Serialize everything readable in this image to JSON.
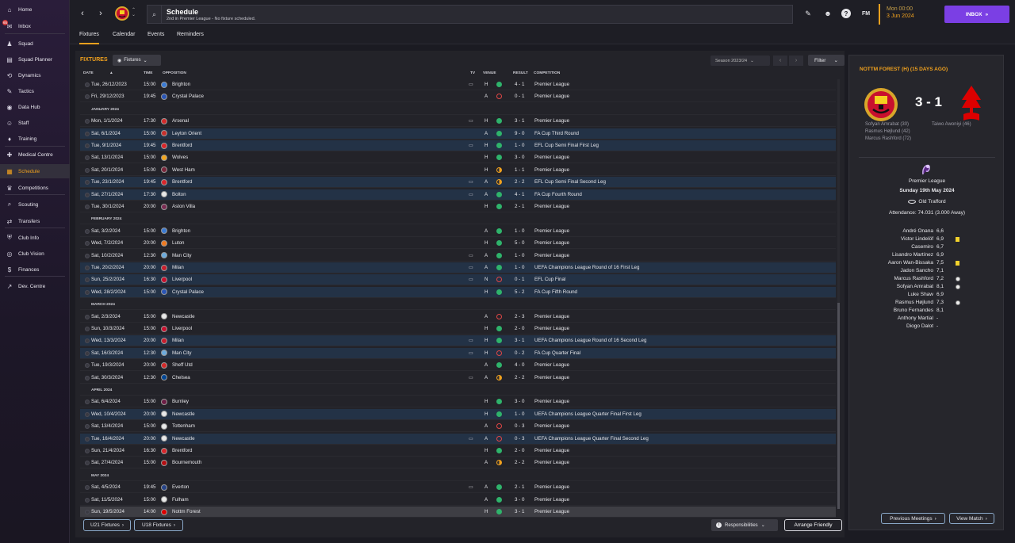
{
  "sidebar": {
    "items": [
      {
        "label": "Home",
        "icon": "⌂",
        "name": "home"
      },
      {
        "label": "Inbox",
        "icon": "✉",
        "name": "inbox",
        "badge": "65"
      },
      {
        "label": "Squad",
        "icon": "♟",
        "name": "squad"
      },
      {
        "label": "Squad Planner",
        "icon": "▤",
        "name": "squad-planner"
      },
      {
        "label": "Dynamics",
        "icon": "⟲",
        "name": "dynamics"
      },
      {
        "label": "Tactics",
        "icon": "✎",
        "name": "tactics"
      },
      {
        "label": "Data Hub",
        "icon": "◉",
        "name": "data-hub"
      },
      {
        "label": "Staff",
        "icon": "☺",
        "name": "staff"
      },
      {
        "label": "Training",
        "icon": "♦",
        "name": "training"
      },
      {
        "label": "Medical Centre",
        "icon": "✚",
        "name": "medical-centre"
      },
      {
        "label": "Schedule",
        "icon": "▦",
        "name": "schedule",
        "active": true
      },
      {
        "label": "Competitions",
        "icon": "♛",
        "name": "competitions"
      },
      {
        "label": "Scouting",
        "icon": "⌕",
        "name": "scouting"
      },
      {
        "label": "Transfers",
        "icon": "⇄",
        "name": "transfers"
      },
      {
        "label": "Club Info",
        "icon": "⛨",
        "name": "club-info"
      },
      {
        "label": "Club Vision",
        "icon": "◎",
        "name": "club-vision"
      },
      {
        "label": "Finances",
        "icon": "$",
        "name": "finances"
      },
      {
        "label": "Dev. Centre",
        "icon": "↗",
        "name": "dev-centre"
      }
    ]
  },
  "topbar": {
    "title": "Schedule",
    "subtitle": "2nd in Premier League - No fixture scheduled.",
    "time": "Mon 00:00",
    "date": "3 Jun 2024",
    "inbox_label": "INBOX",
    "fm_label": "FM"
  },
  "tabs": [
    "Fixtures",
    "Calendar",
    "Events",
    "Reminders"
  ],
  "fixtures": {
    "title": "FIXTURES",
    "view_label": "Fixtures",
    "season_label": "Season 2023/24",
    "filter_label": "Filter",
    "headers": {
      "date": "DATE",
      "time": "TIME",
      "opposition": "OPPOSITION",
      "tv": "TV",
      "venue": "VENUE",
      "result": "RESULT",
      "competition": "COMPETITION"
    },
    "rows": [
      {
        "date": "Tue, 26/12/2023",
        "time": "15:00",
        "opp": "Brighton",
        "crest": "#3b7bd4",
        "tv": true,
        "venue": "H",
        "res": "W",
        "score": "4 - 1",
        "comp": "Premier League"
      },
      {
        "date": "Fri, 29/12/2023",
        "time": "19:45",
        "opp": "Crystal Palace",
        "crest": "#2a55b5",
        "tv": false,
        "venue": "A",
        "res": "L",
        "score": "0 - 1",
        "comp": "Premier League"
      },
      {
        "month": "JANUARY 2024"
      },
      {
        "date": "Mon, 1/1/2024",
        "time": "17:30",
        "opp": "Arsenal",
        "crest": "#d42a2a",
        "tv": true,
        "venue": "H",
        "res": "W",
        "score": "3 - 1",
        "comp": "Premier League"
      },
      {
        "date": "Sat, 6/1/2024",
        "time": "15:00",
        "opp": "Leyton Orient",
        "crest": "#c9302c",
        "tv": false,
        "venue": "A",
        "res": "W",
        "score": "9 - 0",
        "comp": "FA Cup Third Round",
        "hl": true
      },
      {
        "date": "Tue, 9/1/2024",
        "time": "19:45",
        "opp": "Brentford",
        "crest": "#d9262b",
        "tv": true,
        "venue": "H",
        "res": "W",
        "score": "1 - 0",
        "comp": "EFL Cup Semi Final First Leg",
        "hl": true
      },
      {
        "date": "Sat, 13/1/2024",
        "time": "15:00",
        "opp": "Wolves",
        "crest": "#f2a51e",
        "tv": false,
        "venue": "H",
        "res": "W",
        "score": "3 - 0",
        "comp": "Premier League"
      },
      {
        "date": "Sat, 20/1/2024",
        "time": "15:00",
        "opp": "West Ham",
        "crest": "#7a263a",
        "tv": false,
        "venue": "H",
        "res": "D",
        "score": "1 - 1",
        "comp": "Premier League"
      },
      {
        "date": "Tue, 23/1/2024",
        "time": "19:45",
        "opp": "Brentford",
        "crest": "#d9262b",
        "tv": true,
        "venue": "A",
        "res": "D",
        "score": "2 - 2",
        "comp": "EFL Cup Semi Final Second Leg",
        "hl": true
      },
      {
        "date": "Sat, 27/1/2024",
        "time": "17:30",
        "opp": "Bolton",
        "crest": "#e8e8e8",
        "tv": true,
        "venue": "A",
        "res": "W",
        "score": "4 - 1",
        "comp": "FA Cup Fourth Round",
        "hl": true
      },
      {
        "date": "Tue, 30/1/2024",
        "time": "20:00",
        "opp": "Aston Villa",
        "crest": "#7b2c52",
        "tv": false,
        "venue": "H",
        "res": "W",
        "score": "2 - 1",
        "comp": "Premier League"
      },
      {
        "month": "FEBRUARY 2024"
      },
      {
        "date": "Sat, 3/2/2024",
        "time": "15:00",
        "opp": "Brighton",
        "crest": "#3b7bd4",
        "tv": false,
        "venue": "A",
        "res": "W",
        "score": "1 - 0",
        "comp": "Premier League"
      },
      {
        "date": "Wed, 7/2/2024",
        "time": "20:00",
        "opp": "Luton",
        "crest": "#f07a20",
        "tv": false,
        "venue": "H",
        "res": "W",
        "score": "5 - 0",
        "comp": "Premier League"
      },
      {
        "date": "Sat, 10/2/2024",
        "time": "12:30",
        "opp": "Man City",
        "crest": "#6cabdd",
        "tv": true,
        "venue": "A",
        "res": "W",
        "score": "1 - 0",
        "comp": "Premier League"
      },
      {
        "date": "Tue, 20/2/2024",
        "time": "20:00",
        "opp": "Milan",
        "crest": "#c81e2e",
        "tv": true,
        "venue": "A",
        "res": "W",
        "score": "1 - 0",
        "comp": "UEFA Champions League Round of 16  First Leg",
        "hl": true
      },
      {
        "date": "Sun, 25/2/2024",
        "time": "16:30",
        "opp": "Liverpool",
        "crest": "#c8102e",
        "tv": true,
        "venue": "N",
        "res": "L",
        "score": "0 - 1",
        "comp": "EFL Cup Final",
        "hl": true
      },
      {
        "date": "Wed, 28/2/2024",
        "time": "15:00",
        "opp": "Crystal Palace",
        "crest": "#2a55b5",
        "tv": false,
        "venue": "H",
        "res": "W",
        "score": "5 - 2",
        "comp": "FA Cup Fifth Round",
        "hl": true
      },
      {
        "month": "MARCH 2024"
      },
      {
        "date": "Sat, 2/3/2024",
        "time": "15:00",
        "opp": "Newcastle",
        "crest": "#e8e8e8",
        "tv": false,
        "venue": "A",
        "res": "L",
        "score": "2 - 3",
        "comp": "Premier League"
      },
      {
        "date": "Sun, 10/3/2024",
        "time": "15:00",
        "opp": "Liverpool",
        "crest": "#c8102e",
        "tv": false,
        "venue": "H",
        "res": "W",
        "score": "2 - 0",
        "comp": "Premier League"
      },
      {
        "date": "Wed, 13/3/2024",
        "time": "20:00",
        "opp": "Milan",
        "crest": "#c81e2e",
        "tv": true,
        "venue": "H",
        "res": "W",
        "score": "3 - 1",
        "comp": "UEFA Champions League Round of 16  Second Leg",
        "hl": true
      },
      {
        "date": "Sat, 16/3/2024",
        "time": "12:30",
        "opp": "Man City",
        "crest": "#6cabdd",
        "tv": true,
        "venue": "H",
        "res": "L",
        "score": "0 - 2",
        "comp": "FA Cup Quarter Final",
        "hl": true
      },
      {
        "date": "Tue, 19/3/2024",
        "time": "20:00",
        "opp": "Sheff Utd",
        "crest": "#d32a2a",
        "tv": false,
        "venue": "A",
        "res": "W",
        "score": "4 - 0",
        "comp": "Premier League"
      },
      {
        "date": "Sat, 30/3/2024",
        "time": "12:30",
        "opp": "Chelsea",
        "crest": "#034694",
        "tv": true,
        "venue": "A",
        "res": "D",
        "score": "2 - 2",
        "comp": "Premier League"
      },
      {
        "month": "APRIL 2024"
      },
      {
        "date": "Sat, 6/4/2024",
        "time": "15:00",
        "opp": "Burnley",
        "crest": "#6c1d45",
        "tv": false,
        "venue": "H",
        "res": "W",
        "score": "3 - 0",
        "comp": "Premier League"
      },
      {
        "date": "Wed, 10/4/2024",
        "time": "20:00",
        "opp": "Newcastle",
        "crest": "#e8e8e8",
        "tv": false,
        "venue": "H",
        "res": "W",
        "score": "1 - 0",
        "comp": "UEFA Champions League Quarter Final First Leg",
        "hl": true
      },
      {
        "date": "Sat, 13/4/2024",
        "time": "15:00",
        "opp": "Tottenham",
        "crest": "#e8e8e8",
        "tv": false,
        "venue": "A",
        "res": "L",
        "score": "0 - 3",
        "comp": "Premier League"
      },
      {
        "date": "Tue, 16/4/2024",
        "time": "20:00",
        "opp": "Newcastle",
        "crest": "#e8e8e8",
        "tv": true,
        "venue": "A",
        "res": "L",
        "score": "0 - 3",
        "comp": "UEFA Champions League Quarter Final Second Leg",
        "hl": true
      },
      {
        "date": "Sun, 21/4/2024",
        "time": "16:30",
        "opp": "Brentford",
        "crest": "#d9262b",
        "tv": false,
        "venue": "H",
        "res": "W",
        "score": "2 - 0",
        "comp": "Premier League"
      },
      {
        "date": "Sat, 27/4/2024",
        "time": "15:00",
        "opp": "Bournemouth",
        "crest": "#b50e12",
        "tv": false,
        "venue": "A",
        "res": "D",
        "score": "2 - 2",
        "comp": "Premier League"
      },
      {
        "month": "MAY 2024"
      },
      {
        "date": "Sat, 4/5/2024",
        "time": "19:45",
        "opp": "Everton",
        "crest": "#274488",
        "tv": true,
        "venue": "A",
        "res": "W",
        "score": "2 - 1",
        "comp": "Premier League"
      },
      {
        "date": "Sat, 11/5/2024",
        "time": "15:00",
        "opp": "Fulham",
        "crest": "#e8e8e8",
        "tv": false,
        "venue": "A",
        "res": "W",
        "score": "3 - 0",
        "comp": "Premier League"
      },
      {
        "date": "Sun, 19/5/2024",
        "time": "14:00",
        "opp": "Nottm Forest",
        "crest": "#dd0000",
        "tv": false,
        "venue": "H",
        "res": "W",
        "score": "3 - 1",
        "comp": "Premier League",
        "cur": true
      }
    ]
  },
  "bottom": {
    "u21_label": "U21 Fixtures",
    "u18_label": "U18 Fixtures",
    "responsibilities_label": "Responsibilities",
    "arrange_label": "Arrange Friendly"
  },
  "match": {
    "heading": "NOTTM FOREST (H) (15 DAYS AGO)",
    "score": "3 - 1",
    "home_scorers": [
      "Sofyan Amrabat (30)",
      "Rasmus Højlund (42)",
      "Marcus Rashford (72)"
    ],
    "away_scorers": [
      "Taiwo Awoniyi (46)"
    ],
    "competition": "Premier League",
    "date": "Sunday 19th May 2024",
    "venue": "Old Trafford",
    "attendance": "Attendance: 74.031 (3.000 Away)",
    "lineup": [
      {
        "name": "André Onana",
        "rating": "6,6",
        "mark": ""
      },
      {
        "name": "Victor Lindelöf",
        "rating": "6,9",
        "mark": "yellow"
      },
      {
        "name": "Casemiro",
        "rating": "6,7",
        "mark": ""
      },
      {
        "name": "Lisandro Martínez",
        "rating": "6,9",
        "mark": ""
      },
      {
        "name": "Aaron Wan-Bissaka",
        "rating": "7,5",
        "mark": "yellow"
      },
      {
        "name": "Jadon Sancho",
        "rating": "7,1",
        "mark": ""
      },
      {
        "name": "Marcus Rashford",
        "rating": "7,2",
        "mark": "goal"
      },
      {
        "name": "Sofyan Amrabat",
        "rating": "8,1",
        "mark": "goal"
      },
      {
        "name": "Luke Shaw",
        "rating": "6,9",
        "mark": ""
      },
      {
        "name": "Rasmus Højlund",
        "rating": "7,3",
        "mark": "goal"
      },
      {
        "name": "Bruno Fernandes",
        "rating": "8,1",
        "mark": ""
      },
      {
        "name": "Anthony Martial",
        "rating": "-",
        "mark": ""
      },
      {
        "name": "Diogo Dalot",
        "rating": "-",
        "mark": ""
      }
    ],
    "prev_meetings_label": "Previous Meetings",
    "view_match_label": "View Match"
  },
  "colors": {
    "accent": "#f0a11e",
    "win": "#2fb36b",
    "loss": "#e04646",
    "inbox": "#7b3fe4",
    "highlight_row": "#233246"
  }
}
